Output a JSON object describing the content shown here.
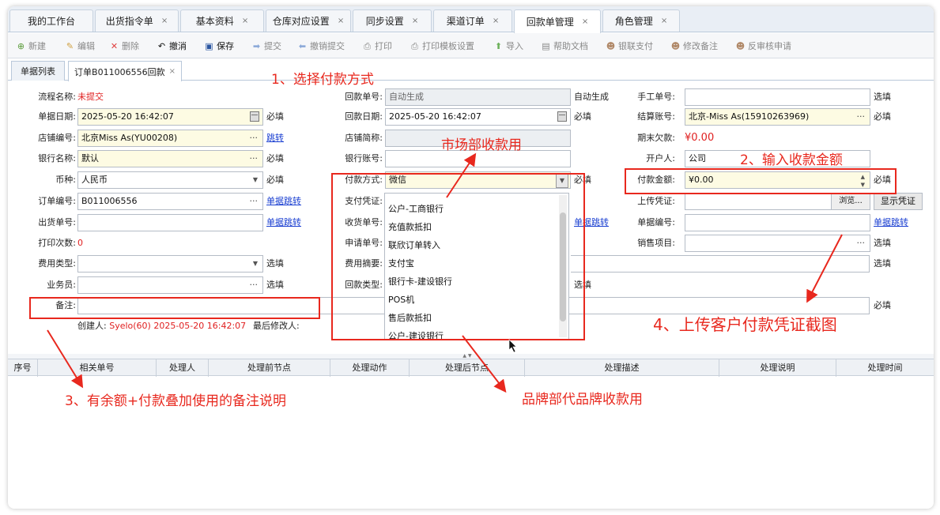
{
  "tabs": [
    {
      "label": "我的工作台",
      "closable": false
    },
    {
      "label": "出货指令单",
      "closable": true
    },
    {
      "label": "基本资料",
      "closable": true
    },
    {
      "label": "仓库对应设置",
      "closable": true
    },
    {
      "label": "同步设置",
      "closable": true
    },
    {
      "label": "渠道订单",
      "closable": true
    },
    {
      "label": "回款单管理",
      "closable": true,
      "active": true
    },
    {
      "label": "角色管理",
      "closable": true
    }
  ],
  "close_glyph": "×",
  "toolbar": [
    {
      "label": "新建",
      "icon": "plus-circle-icon",
      "glyph": "⊕",
      "enabled": false
    },
    {
      "label": "编辑",
      "icon": "pencil-icon",
      "glyph": "✎",
      "enabled": false
    },
    {
      "label": "删除",
      "icon": "delete-x-icon",
      "glyph": "✕",
      "enabled": false
    },
    {
      "label": "撤消",
      "icon": "undo-icon",
      "glyph": "↶",
      "enabled": true
    },
    {
      "label": "保存",
      "icon": "floppy-icon",
      "glyph": "▣",
      "enabled": true
    },
    {
      "label": "提交",
      "icon": "arrow-right-icon",
      "glyph": "➡",
      "enabled": false
    },
    {
      "label": "撤销提交",
      "icon": "arrow-left-icon",
      "glyph": "⬅",
      "enabled": false
    },
    {
      "label": "打印",
      "icon": "printer-icon",
      "glyph": "⎙",
      "enabled": false
    },
    {
      "label": "打印模板设置",
      "icon": "printer-settings-icon",
      "glyph": "⎙",
      "enabled": false
    },
    {
      "label": "导入",
      "icon": "import-icon",
      "glyph": "⬆",
      "enabled": false
    },
    {
      "label": "帮助文档",
      "icon": "help-doc-icon",
      "glyph": "▤",
      "enabled": false
    },
    {
      "label": "银联支付",
      "icon": "user-pay-icon",
      "glyph": "☻",
      "enabled": false
    },
    {
      "label": "修改备注",
      "icon": "user-edit-icon",
      "glyph": "☻",
      "enabled": false
    },
    {
      "label": "反审核申请",
      "icon": "user-review-icon",
      "glyph": "☻",
      "enabled": false
    }
  ],
  "subtabs": [
    {
      "label": "单据列表"
    },
    {
      "label": "订单B011006556回款",
      "closable": true
    }
  ],
  "form": {
    "flow_name": {
      "label": "流程名称:",
      "value": "未提交"
    },
    "doc_date": {
      "label": "单据日期:",
      "value": "2025-05-20 16:42:07",
      "suffix": "必填"
    },
    "store_code": {
      "label": "店铺编号:",
      "value": "北京Miss As(YU00208)",
      "link": "跳转"
    },
    "bank_name": {
      "label": "银行名称:",
      "value": "默认",
      "suffix": "必填"
    },
    "currency": {
      "label": "币种:",
      "value": "人民币",
      "suffix": "必填"
    },
    "order_no": {
      "label": "订单编号:",
      "value": "B011006556",
      "link": "单据跳转"
    },
    "ship_no": {
      "label": "出货单号:",
      "value": "",
      "link": "单据跳转"
    },
    "print_count": {
      "label": "打印次数:",
      "value": "0"
    },
    "fee_type": {
      "label": "费用类型:",
      "value": "",
      "suffix": "选填"
    },
    "salesman": {
      "label": "业务员:",
      "value": "",
      "suffix": "选填"
    },
    "remark": {
      "label": "备注:",
      "value": ""
    },
    "creator": {
      "label": "创建人:",
      "value": "Syelo(60) 2025-05-20 16:42:07"
    },
    "modifier": {
      "label": "最后修改人:",
      "value": ""
    },
    "refund_no": {
      "label": "回款单号:",
      "value": "自动生成",
      "suffix": "自动生成"
    },
    "refund_date": {
      "label": "回款日期:",
      "value": "2025-05-20 16:42:07",
      "suffix": "必填"
    },
    "store_short": {
      "label": "店铺简称:",
      "value": ""
    },
    "bank_account": {
      "label": "银行账号:",
      "value": ""
    },
    "pay_method": {
      "label": "付款方式:",
      "value": "微信",
      "suffix": "必填"
    },
    "pay_voucher": {
      "label": "支付凭证:"
    },
    "receipt_no": {
      "label": "收货单号:",
      "link": "单据跳转"
    },
    "apply_no": {
      "label": "申请单号:"
    },
    "fee_summary": {
      "label": "费用摘要:"
    },
    "refund_type": {
      "label": "回款类型:",
      "suffix": "选填"
    },
    "manual_no": {
      "label": "手工单号:",
      "value": "",
      "suffix": "选填"
    },
    "settle_account": {
      "label": "结算账号:",
      "value": "北京-Miss As(15910263969)",
      "suffix": "必填"
    },
    "end_debt": {
      "label": "期末欠款:",
      "value": "¥0.00"
    },
    "account_holder": {
      "label": "开户人:",
      "value": "公司"
    },
    "pay_amount": {
      "label": "付款金额:",
      "value": "¥0.00",
      "suffix": "必填"
    },
    "upload_voucher": {
      "label": "上传凭证:",
      "value": "",
      "browse": "浏览...",
      "show": "显示凭证"
    },
    "doc_no": {
      "label": "单据编号:",
      "value": "",
      "link": "单据跳转"
    },
    "sales_item": {
      "label": "销售项目:",
      "value": "",
      "suffix": "选填"
    },
    "row_suffix_select": "选填",
    "row_suffix_required": "必填"
  },
  "dropdown": [
    "公户-工商银行",
    "充值款抵扣",
    "联欣订单转入",
    "支付宝",
    "银行卡-建设银行",
    "POS机",
    "售后款抵扣",
    "公户-建设银行"
  ],
  "grid_headers": [
    "序号",
    "相关单号",
    "处理人",
    "处理前节点",
    "处理动作",
    "处理后节点",
    "处理描述",
    "处理说明",
    "处理时间"
  ],
  "annotations": {
    "step1": "1、选择付款方式",
    "step2": "2、输入收款金额",
    "step3": "3、有余额+付款叠加使用的备注说明",
    "step4": "4、上传客户付款凭证截图",
    "market": "市场部收款用",
    "brand": "品牌部代品牌收款用"
  },
  "colors": {
    "annotation": "#e8281e",
    "link": "#1a3fd1",
    "required_bg": "#fdfbe3"
  }
}
